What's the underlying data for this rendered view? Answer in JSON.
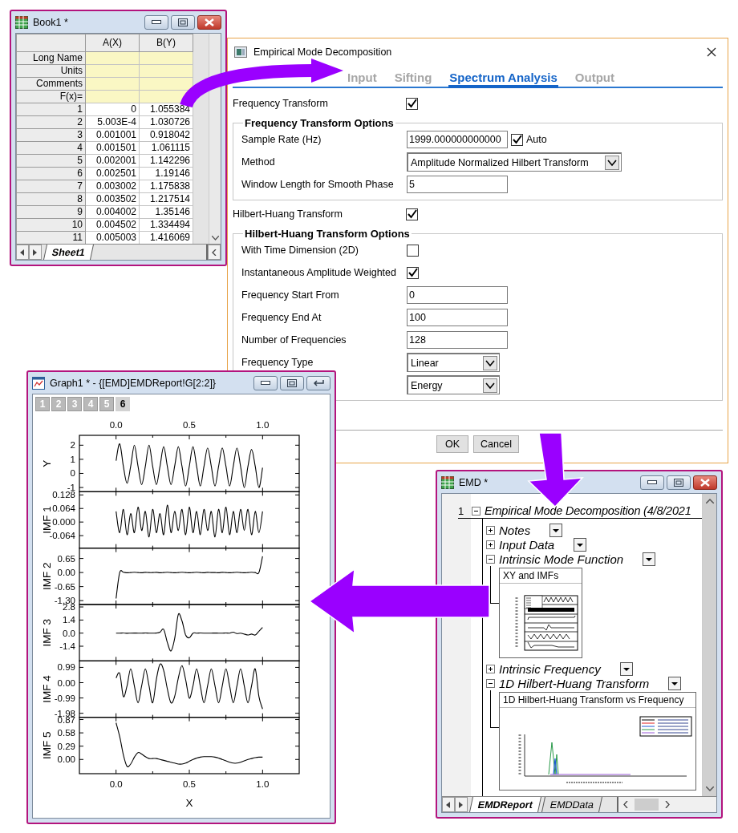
{
  "worksheet": {
    "title": "Book1 *",
    "columns": [
      "A(X)",
      "B(Y)"
    ],
    "label_rows": [
      "Long Name",
      "Units",
      "Comments",
      "F(x)="
    ],
    "rows": [
      {
        "label": "1",
        "cells": [
          "0",
          "1.055384"
        ]
      },
      {
        "label": "2",
        "cells": [
          "5.003E-4",
          "1.030726"
        ]
      },
      {
        "label": "3",
        "cells": [
          "0.001001",
          "0.918042"
        ]
      },
      {
        "label": "4",
        "cells": [
          "0.001501",
          "1.061115"
        ]
      },
      {
        "label": "5",
        "cells": [
          "0.002001",
          "1.142296"
        ]
      },
      {
        "label": "6",
        "cells": [
          "0.002501",
          "1.19146"
        ]
      },
      {
        "label": "7",
        "cells": [
          "0.003002",
          "1.175838"
        ]
      },
      {
        "label": "8",
        "cells": [
          "0.003502",
          "1.217514"
        ]
      },
      {
        "label": "9",
        "cells": [
          "0.004002",
          "1.35146"
        ]
      },
      {
        "label": "10",
        "cells": [
          "0.004502",
          "1.334494"
        ]
      },
      {
        "label": "11",
        "cells": [
          "0.005003",
          "1.416069"
        ]
      }
    ],
    "sheet_tabs": [
      {
        "label": "Sheet1",
        "selected": true
      }
    ]
  },
  "dialog": {
    "title": "Empirical Mode Decomposition",
    "tabs": [
      {
        "label": "Input",
        "selected": false
      },
      {
        "label": "Sifting",
        "selected": false
      },
      {
        "label": "Spectrum Analysis",
        "selected": true
      },
      {
        "label": "Output",
        "selected": false
      }
    ],
    "items": [
      {
        "kind": "checkbox",
        "label": "Frequency Transform",
        "checked": true
      },
      {
        "kind": "group",
        "legend": "Frequency Transform Options",
        "items": [
          {
            "kind": "text_auto",
            "label": "Sample Rate (Hz)",
            "value": "1999.000000000000",
            "auto_label": "Auto",
            "checked": true
          },
          {
            "kind": "dropdown",
            "label": "Method",
            "value": "Amplitude Normalized Hilbert Transform"
          },
          {
            "kind": "text",
            "label": "Window Length for Smooth Phase",
            "value": "5"
          }
        ]
      },
      {
        "kind": "checkbox",
        "label": "Hilbert-Huang Transform",
        "checked": true
      },
      {
        "kind": "group",
        "legend": "Hilbert-Huang Transform Options",
        "items": [
          {
            "kind": "checkbox",
            "label": "With Time Dimension (2D)",
            "checked": false
          },
          {
            "kind": "checkbox",
            "label": "Instantaneous Amplitude Weighted",
            "checked": true
          },
          {
            "kind": "text",
            "label": "Frequency Start From",
            "value": "0"
          },
          {
            "kind": "text",
            "label": "Frequency End At",
            "value": "100"
          },
          {
            "kind": "text",
            "label": "Number of Frequencies",
            "value": "128"
          },
          {
            "kind": "dropdown",
            "label": "Frequency Type",
            "value": "Linear"
          },
          {
            "kind": "dropdown",
            "value": "Energy"
          }
        ]
      }
    ],
    "buttons": [
      "OK",
      "Cancel"
    ]
  },
  "graph": {
    "title": "Graph1 * - {[EMD]EMDReport!G[2:2]}",
    "layer_tabs": [
      {
        "label": "1",
        "selected": false
      },
      {
        "label": "2",
        "selected": false
      },
      {
        "label": "3",
        "selected": false
      },
      {
        "label": "4",
        "selected": false
      },
      {
        "label": "5",
        "selected": false
      },
      {
        "label": "6",
        "selected": true
      }
    ],
    "panels": [
      {
        "chart_data": {
          "type": "line",
          "ylabel": "Y",
          "xlim": [
            -0.25,
            1.25
          ],
          "ylim": [
            -1.3,
            2.7
          ],
          "xticks": [
            {
              "value": 0,
              "label": "0.0"
            },
            {
              "value": 0.5,
              "label": "0.5"
            },
            {
              "value": 1,
              "label": "1.0"
            }
          ],
          "yticks": [
            2,
            1,
            0,
            -1
          ],
          "x": [
            0,
            0.025,
            0.05,
            0.075,
            0.1,
            0.125,
            0.15,
            0.175,
            0.2,
            0.225,
            0.25,
            0.275,
            0.3,
            0.325,
            0.35,
            0.375,
            0.4,
            0.425,
            0.45,
            0.475,
            0.5,
            0.525,
            0.55,
            0.575,
            0.6,
            0.625,
            0.65,
            0.675,
            0.7,
            0.725,
            0.75,
            0.775,
            0.8,
            0.825,
            0.85,
            0.875,
            0.9,
            0.925,
            0.95,
            0.975,
            1
          ],
          "values": [
            0.9,
            2.1,
            0.5,
            -0.7,
            0.5,
            2.0,
            0.5,
            -0.8,
            0.5,
            2.0,
            0.5,
            -0.8,
            0.5,
            1.9,
            0.5,
            -0.8,
            0.5,
            1.9,
            0.5,
            -0.9,
            0.5,
            1.9,
            0.5,
            -0.9,
            0.5,
            1.8,
            0.5,
            -0.9,
            0.5,
            1.8,
            0.5,
            -0.9,
            0.5,
            1.8,
            0.5,
            -1.0,
            0.5,
            1.7,
            0.5,
            -1.0,
            0.4
          ]
        }
      },
      {
        "chart_data": {
          "type": "line",
          "ylabel": "IMF 1",
          "xlim": [
            -0.25,
            1.25
          ],
          "ylim": [
            -0.123,
            0.143
          ],
          "yticks": [
            {
              "value": 0.128,
              "label": "0.128"
            },
            {
              "value": 0.064,
              "label": "0.064"
            },
            {
              "value": 0,
              "label": "0.000"
            },
            {
              "value": -0.064,
              "label": "-0.064"
            }
          ],
          "x": [
            0,
            0.025,
            0.05,
            0.075,
            0.1,
            0.125,
            0.15,
            0.175,
            0.2,
            0.225,
            0.25,
            0.275,
            0.3,
            0.325,
            0.35,
            0.375,
            0.4,
            0.425,
            0.45,
            0.475,
            0.5,
            0.525,
            0.55,
            0.575,
            0.6,
            0.625,
            0.65,
            0.675,
            0.7,
            0.725,
            0.75,
            0.775,
            0.8,
            0.825,
            0.85,
            0.875,
            0.9,
            0.925,
            0.95,
            0.975,
            1
          ],
          "values": [
            0.05,
            -0.05,
            0.06,
            -0.06,
            0.04,
            -0.05,
            0.07,
            -0.04,
            0.05,
            -0.07,
            0.06,
            -0.05,
            0.04,
            -0.06,
            0.08,
            -0.05,
            0.05,
            -0.04,
            0.06,
            -0.06,
            0.07,
            -0.05,
            0.05,
            -0.06,
            0.06,
            -0.04,
            0.05,
            -0.07,
            0.06,
            -0.05,
            0.07,
            -0.06,
            0.05,
            -0.05,
            0.06,
            -0.04,
            0.06,
            -0.06,
            0.05,
            -0.05,
            0.05
          ]
        }
      },
      {
        "chart_data": {
          "type": "line",
          "ylabel": "IMF 2",
          "xlim": [
            -0.25,
            1.25
          ],
          "ylim": [
            -1.48,
            1.13
          ],
          "yticks": [
            {
              "value": 0.65,
              "label": "0.65"
            },
            {
              "value": 0,
              "label": "0.00"
            },
            {
              "value": -0.65,
              "label": "-0.65"
            },
            {
              "value": -1.3,
              "label": "-1.30"
            }
          ],
          "x": [
            0,
            0.025,
            0.05,
            0.075,
            0.1,
            0.125,
            0.15,
            0.175,
            0.2,
            0.225,
            0.25,
            0.275,
            0.3,
            0.325,
            0.35,
            0.375,
            0.4,
            0.425,
            0.45,
            0.475,
            0.5,
            0.525,
            0.55,
            0.575,
            0.6,
            0.625,
            0.65,
            0.675,
            0.7,
            0.725,
            0.75,
            0.775,
            0.8,
            0.825,
            0.85,
            0.875,
            0.9,
            0.925,
            0.95,
            0.975,
            1
          ],
          "values": [
            -1.2,
            0.0,
            0.01,
            -0.01,
            0.0,
            0.01,
            0.0,
            -0.01,
            0.01,
            0.0,
            0.0,
            0.01,
            -0.01,
            0.0,
            0.01,
            0.0,
            -0.01,
            0.0,
            0.01,
            0.0,
            -0.01,
            0.0,
            0.01,
            0.0,
            -0.01,
            0.01,
            0.0,
            0.0,
            -0.01,
            0.01,
            0.0,
            -0.01,
            0.0,
            0.01,
            0.0,
            -0.01,
            0.0,
            0.01,
            0.0,
            0.0,
            0.75
          ]
        }
      },
      {
        "chart_data": {
          "type": "line",
          "ylabel": "IMF 3",
          "xlim": [
            -0.25,
            1.25
          ],
          "ylim": [
            -2.97,
            3.06
          ],
          "yticks": [
            {
              "value": 2.8,
              "label": "2.8"
            },
            {
              "value": 1.4,
              "label": "1.4"
            },
            {
              "value": 0,
              "label": "0.0"
            },
            {
              "value": -1.4,
              "label": "-1.4"
            }
          ],
          "x": [
            0,
            0.025,
            0.05,
            0.075,
            0.1,
            0.125,
            0.15,
            0.175,
            0.2,
            0.225,
            0.25,
            0.275,
            0.3,
            0.325,
            0.35,
            0.375,
            0.4,
            0.425,
            0.45,
            0.475,
            0.5,
            0.525,
            0.55,
            0.575,
            0.6,
            0.625,
            0.65,
            0.675,
            0.7,
            0.725,
            0.75,
            0.775,
            0.8,
            0.825,
            0.85,
            0.875,
            0.9,
            0.925,
            0.95,
            0.975,
            1
          ],
          "values": [
            0,
            0,
            0.02,
            -0.02,
            0,
            0.01,
            0,
            -0.01,
            0.02,
            0,
            0,
            0.01,
            0.1,
            0.4,
            -1.0,
            -1.9,
            -0.6,
            2.0,
            1.3,
            -0.2,
            -0.5,
            0.0,
            0,
            0.02,
            0,
            -0.01,
            0,
            0.01,
            0,
            0,
            0.02,
            0,
            0.1,
            -0.05,
            0,
            -0.1,
            -0.2,
            -0.1,
            -0.2,
            0.2,
            0.6
          ]
        }
      },
      {
        "chart_data": {
          "type": "line",
          "ylabel": "IMF 4",
          "xlim": [
            -0.25,
            1.25
          ],
          "ylim": [
            -2.24,
            1.41
          ],
          "yticks": [
            {
              "value": 0.99,
              "label": "0.99"
            },
            {
              "value": 0,
              "label": "0.00"
            },
            {
              "value": -0.99,
              "label": "-0.99"
            },
            {
              "value": -1.98,
              "label": "-1.98"
            }
          ],
          "x": [
            0,
            0.025,
            0.05,
            0.075,
            0.1,
            0.125,
            0.15,
            0.175,
            0.2,
            0.225,
            0.25,
            0.275,
            0.3,
            0.325,
            0.35,
            0.375,
            0.4,
            0.425,
            0.45,
            0.475,
            0.5,
            0.525,
            0.55,
            0.575,
            0.6,
            0.625,
            0.65,
            0.675,
            0.7,
            0.725,
            0.75,
            0.775,
            0.8,
            0.825,
            0.85,
            0.875,
            0.9,
            0.925,
            0.95,
            0.975,
            1
          ],
          "values": [
            0.3,
            0.6,
            -0.9,
            -0.2,
            0.9,
            -0.2,
            -1.3,
            -0.2,
            0.9,
            -0.2,
            -1.3,
            0.2,
            1.2,
            0.8,
            -0.4,
            -1.3,
            -0.9,
            0.3,
            1.1,
            0.2,
            -1.0,
            -0.2,
            0.9,
            -0.2,
            -1.3,
            -0.2,
            0.9,
            -0.2,
            -1.3,
            -0.2,
            0.9,
            -0.2,
            -1.3,
            -0.2,
            0.9,
            -0.2,
            -1.3,
            -0.2,
            0.9,
            -0.9,
            -1.7
          ]
        }
      },
      {
        "chart_data": {
          "type": "line",
          "ylabel": "IMF 5",
          "xlabel": "X",
          "xlim": [
            -0.25,
            1.25
          ],
          "ylim": [
            -0.31,
            0.92
          ],
          "xticks": [
            {
              "value": 0,
              "label": "0.0"
            },
            {
              "value": 0.5,
              "label": "0.5"
            },
            {
              "value": 1,
              "label": "1.0"
            }
          ],
          "yticks": [
            {
              "value": 0.87,
              "label": "0.87"
            },
            {
              "value": 0.58,
              "label": "0.58"
            },
            {
              "value": 0.29,
              "label": "0.29"
            },
            {
              "value": 0,
              "label": "0.00"
            }
          ],
          "x": [
            0,
            0.025,
            0.05,
            0.075,
            0.1,
            0.125,
            0.15,
            0.175,
            0.2,
            0.225,
            0.25,
            0.275,
            0.3,
            0.325,
            0.35,
            0.375,
            0.4,
            0.425,
            0.45,
            0.475,
            0.5,
            0.525,
            0.55,
            0.575,
            0.6,
            0.625,
            0.65,
            0.675,
            0.7,
            0.725,
            0.75,
            0.775,
            0.8,
            0.825,
            0.85,
            0.875,
            0.9,
            0.925,
            0.95,
            0.975,
            1
          ],
          "values": [
            0.8,
            0.5,
            0.1,
            -0.15,
            -0.1,
            0.05,
            0.15,
            0.12,
            0.06,
            0.02,
            0.02,
            0.02,
            0.0,
            -0.02,
            -0.04,
            -0.06,
            -0.08,
            -0.1,
            -0.1,
            -0.08,
            -0.04,
            0.0,
            0.03,
            0.05,
            0.06,
            0.06,
            0.06,
            0.05,
            0.03,
            0.0,
            -0.03,
            -0.06,
            -0.08,
            -0.08,
            -0.06,
            -0.03,
            0.0,
            0.02,
            0.04,
            0.05,
            0.05
          ]
        }
      }
    ]
  },
  "report": {
    "title": "EMD *",
    "tree": {
      "row_number": "1",
      "label": "Empirical Mode Decomposition (4/8/2021",
      "expanded": true,
      "children": [
        {
          "label": "Notes",
          "expanded": false
        },
        {
          "label": "Input Data",
          "expanded": false
        },
        {
          "label": "Intrinsic Mode Function",
          "expanded": true,
          "graph": {
            "title": "XY and IMFs",
            "kind": "stack"
          }
        },
        {
          "label": "Intrinsic Frequency",
          "expanded": false
        },
        {
          "label": "1D Hilbert-Huang Transform",
          "expanded": true,
          "graph": {
            "title": "1D Hilbert-Huang Transform vs Frequency",
            "kind": "spectrum"
          }
        }
      ]
    },
    "sheet_tabs": [
      {
        "label": "EMDReport",
        "selected": true
      },
      {
        "label": "EMDData",
        "selected": false
      }
    ]
  }
}
